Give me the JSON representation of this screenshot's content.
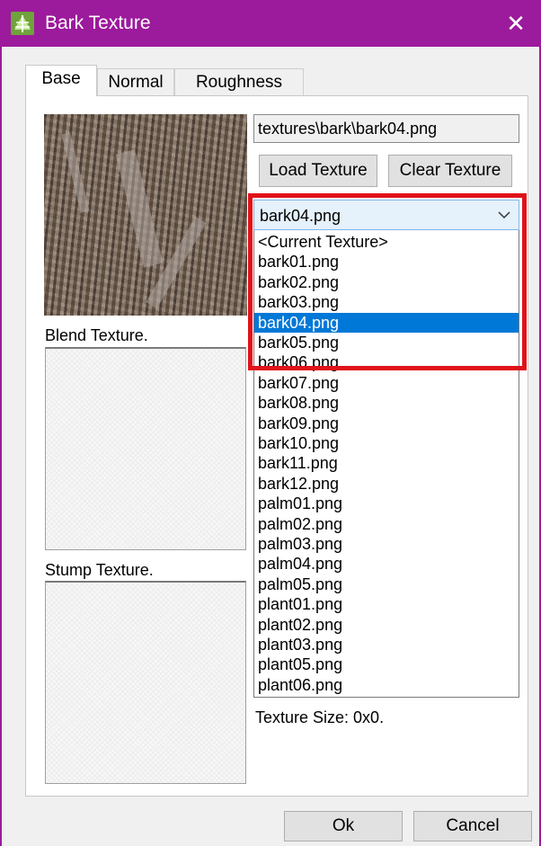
{
  "window": {
    "title": "Bark Texture",
    "close_label": "✕"
  },
  "tabs": [
    {
      "label": "Base",
      "active": true
    },
    {
      "label": "Normal",
      "active": false
    },
    {
      "label": "Roughness",
      "active": false
    }
  ],
  "texture_path": "textures\\bark\\bark04.png",
  "buttons": {
    "load": "Load Texture",
    "clear": "Clear Texture",
    "ok": "Ok",
    "cancel": "Cancel"
  },
  "labels": {
    "blend": "Blend Texture.",
    "stump": "Stump Texture.",
    "texture_size": "Texture Size: 0x0."
  },
  "dropdown": {
    "selected": "bark04.png",
    "options": [
      "<Current Texture>",
      "bark01.png",
      "bark02.png",
      "bark03.png",
      "bark04.png",
      "bark05.png",
      "bark06.png",
      "bark07.png",
      "bark08.png",
      "bark09.png",
      "bark10.png",
      "bark11.png",
      "bark12.png",
      "palm01.png",
      "palm02.png",
      "palm03.png",
      "palm04.png",
      "palm05.png",
      "plant01.png",
      "plant02.png",
      "plant03.png",
      "plant05.png",
      "plant06.png"
    ],
    "selected_index": 4
  },
  "colors": {
    "titlebar": "#9c1a9c",
    "selection": "#0078d7",
    "annotation_box": "#e0121a"
  },
  "icons": {
    "app": "tree-leaf-icon",
    "dropdown": "chevron-down-icon",
    "close": "close-icon"
  }
}
